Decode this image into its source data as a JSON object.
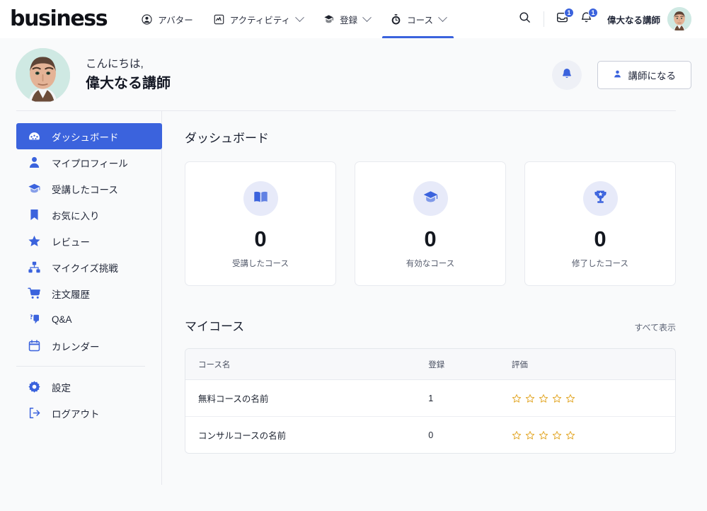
{
  "brand": "business",
  "topnav": {
    "items": [
      {
        "label": "アバター",
        "icon": "user-circle-icon",
        "caret": false,
        "active": false
      },
      {
        "label": "アクティビティ",
        "icon": "activity-chart-icon",
        "caret": true,
        "active": false
      },
      {
        "label": "登録",
        "icon": "enroll-icon",
        "caret": true,
        "active": false
      },
      {
        "label": "コース",
        "icon": "course-clock-icon",
        "caret": true,
        "active": true
      }
    ],
    "search_icon": "search-icon",
    "inbox_icon": "inbox-icon",
    "inbox_badge": "1",
    "bell_icon": "bell-icon",
    "bell_badge": "1",
    "username": "偉大なる講師",
    "avatar": "user-avatar"
  },
  "greeting": {
    "hello": "こんにちは,",
    "name": "偉大なる講師",
    "avatar": "user-avatar",
    "bell_icon": "bell-icon",
    "become_instructor": "講師になる",
    "become_instructor_icon": "person-icon"
  },
  "sidebar": {
    "items": [
      {
        "label": "ダッシュボード",
        "icon": "dashboard-gauge-icon",
        "active": true
      },
      {
        "label": "マイプロフィール",
        "icon": "person-icon",
        "active": false
      },
      {
        "label": "受講したコース",
        "icon": "graduation-cap-icon",
        "active": false
      },
      {
        "label": "お気に入り",
        "icon": "bookmark-icon",
        "active": false
      },
      {
        "label": "レビュー",
        "icon": "star-icon",
        "active": false
      },
      {
        "label": "マイクイズ挑戦",
        "icon": "quiz-sitemap-icon",
        "active": false
      },
      {
        "label": "注文履歴",
        "icon": "shopping-cart-icon",
        "active": false
      },
      {
        "label": "Q&A",
        "icon": "question-answer-icon",
        "active": false
      },
      {
        "label": "カレンダー",
        "icon": "calendar-icon",
        "active": false
      }
    ],
    "items_bottom": [
      {
        "label": "設定",
        "icon": "gear-icon",
        "active": false
      },
      {
        "label": "ログアウト",
        "icon": "logout-icon",
        "active": false
      }
    ]
  },
  "main": {
    "title": "ダッシュボード",
    "cards": [
      {
        "icon": "open-book-icon",
        "value": "0",
        "label": "受講したコース"
      },
      {
        "icon": "graduation-cap-icon",
        "value": "0",
        "label": "有効なコース"
      },
      {
        "icon": "trophy-icon",
        "value": "0",
        "label": "修了したコース"
      }
    ],
    "courses_title": "マイコース",
    "see_all": "すべて表示",
    "table": {
      "headers": [
        "コース名",
        "登録",
        "評価"
      ],
      "rows": [
        {
          "name": "無料コースの名前",
          "enrolled": "1",
          "rating": 0
        },
        {
          "name": "コンサルコースの名前",
          "enrolled": "0",
          "rating": 0
        }
      ],
      "star_count": 5
    }
  },
  "colors": {
    "accent": "#3b63dd",
    "star": "#e3a92c",
    "page_bg": "#f9fafb",
    "border": "#e6e8ed"
  }
}
